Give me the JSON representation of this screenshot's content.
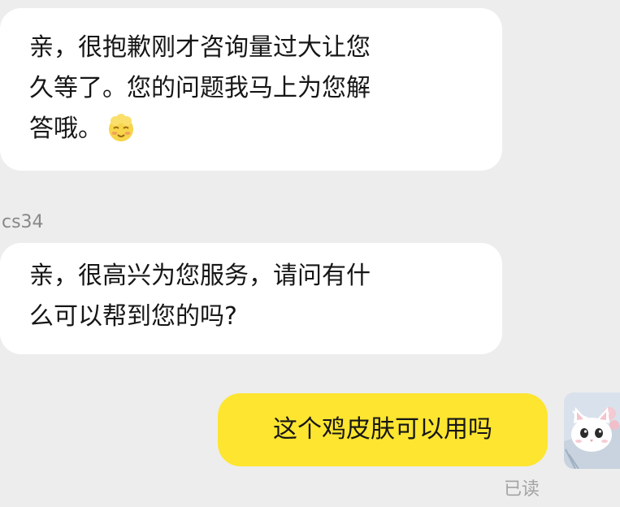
{
  "messages": [
    {
      "lines": [
        "亲，很抱歉刚才咨询量过大让您",
        "久等了。您的问题我马上为您解",
        "答哦。"
      ],
      "emoji": "blush-emoji-icon"
    },
    {
      "sender": "cs34",
      "lines": [
        "亲，很高兴为您服务，请问有什",
        "么可以帮到您的吗?"
      ]
    },
    {
      "text": "这个鸡皮肤可以用吗",
      "status": "已读"
    }
  ],
  "colors": {
    "background": "#ededed",
    "incoming_bubble": "#ffffff",
    "outgoing_bubble": "#fde530",
    "status_text": "#a3a3a3"
  }
}
